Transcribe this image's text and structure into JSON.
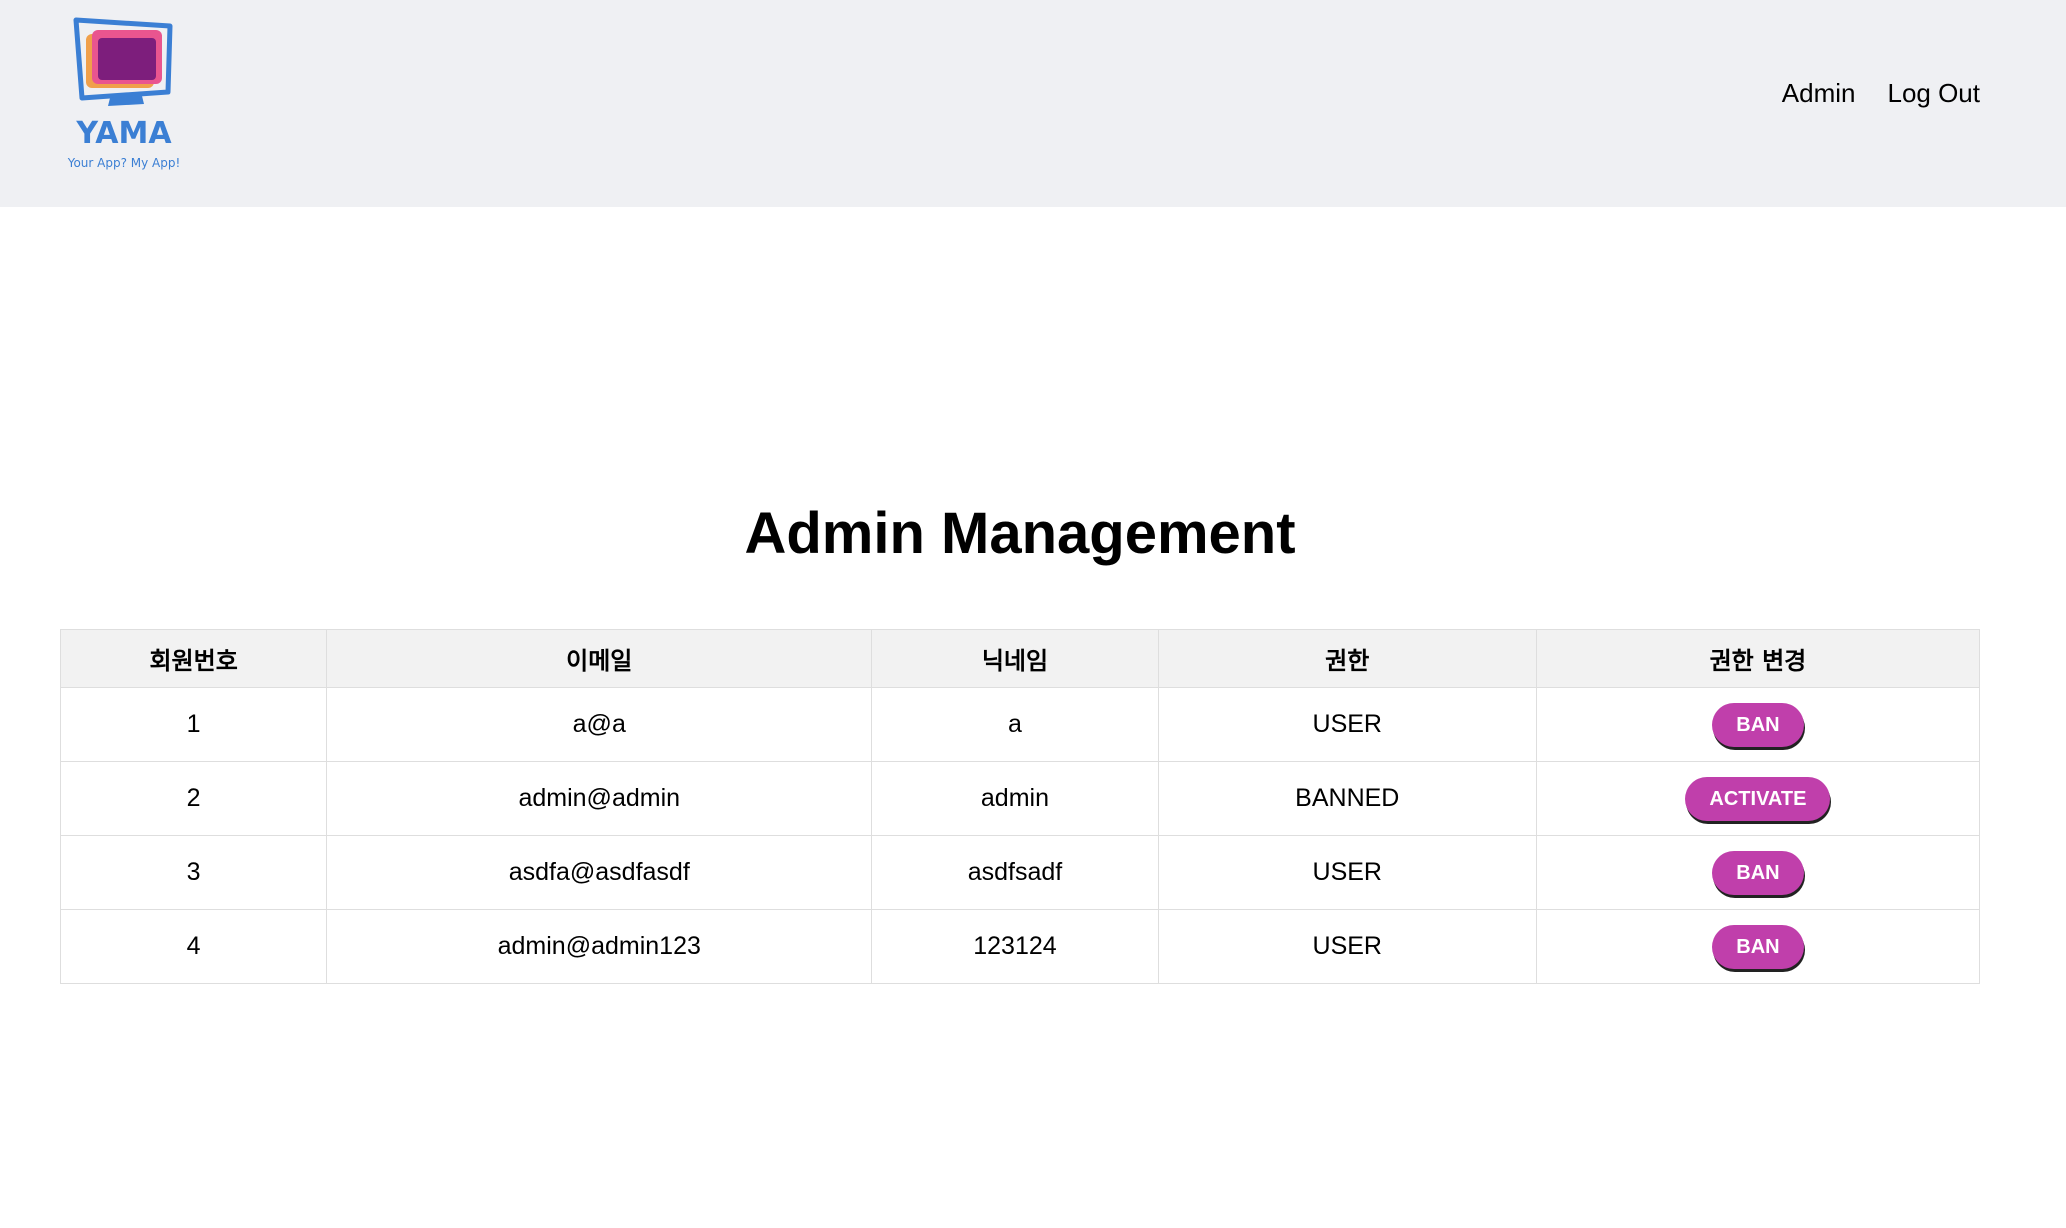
{
  "header": {
    "logo": {
      "name": "YAMA",
      "tagline": "Your App? My App!"
    },
    "nav": [
      {
        "label": "Admin"
      },
      {
        "label": "Log Out"
      }
    ]
  },
  "main": {
    "title": "Admin Management",
    "table": {
      "columns": [
        "회원번호",
        "이메일",
        "닉네임",
        "권한",
        "권한 변경"
      ],
      "rows": [
        {
          "id": "1",
          "email": "a@a",
          "nickname": "a",
          "role": "USER",
          "action": "BAN"
        },
        {
          "id": "2",
          "email": "admin@admin",
          "nickname": "admin",
          "role": "BANNED",
          "action": "ACTIVATE"
        },
        {
          "id": "3",
          "email": "asdfa@asdfasdf",
          "nickname": "asdfsadf",
          "role": "USER",
          "action": "BAN"
        },
        {
          "id": "4",
          "email": "admin@admin123",
          "nickname": "123124",
          "role": "USER",
          "action": "BAN"
        }
      ]
    }
  },
  "colors": {
    "header_bg": "#eff0f3",
    "brand": "#3b7fd4",
    "button": "#c03fab",
    "table_header_bg": "#f2f2f2"
  },
  "icons": {
    "logo": "monitor-logo-icon"
  }
}
